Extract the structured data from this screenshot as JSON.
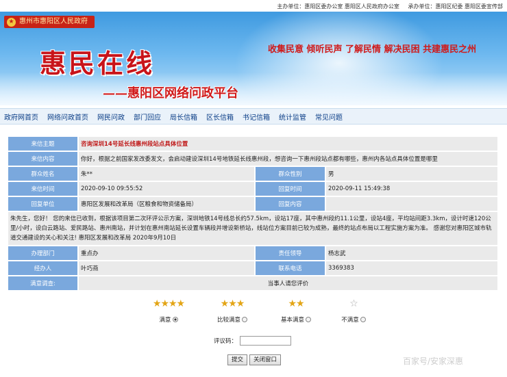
{
  "topbar": {
    "sponsor": "主办单位：惠阳区委办公室 惠阳区人民政府办公室",
    "organizer": "承办单位：惠阳区纪委 惠阳区委宣传部"
  },
  "banner": {
    "gov_badge": "惠州市惠阳区人民政府",
    "main_title": "惠民在线",
    "sub_title": "——惠阳区网络问政平台",
    "slogan": "收集民意  倾听民声  了解民情  解决民困  共建惠民之州"
  },
  "nav": {
    "items": [
      "政府网首页",
      "网络问政首页",
      "网民问政",
      "部门回应",
      "局长信箱",
      "区长信箱",
      "书记信箱",
      "统计监管",
      "常见问题"
    ]
  },
  "detail": {
    "subject_label": "来信主题",
    "subject": "咨询深圳14号延长线惠州段站点具体位置",
    "content_label": "来信内容",
    "content": "你好，根据之前国家发改委发文，会启动建设深圳14号地铁延长线惠州段，想咨询一下惠州段站点都有哪些，惠州内各站点具体位置是哪里",
    "name_label": "群众姓名",
    "name": "朱**",
    "gender_label": "群众性别",
    "gender": "男",
    "sent_time_label": "来信时间",
    "sent_time": "2020-09-10 09:55:52",
    "reply_time_label": "回复时间",
    "reply_time": "2020-09-11 15:49:38",
    "reply_unit_label": "回复单位",
    "reply_unit": "惠阳区发展和改革局（区粮食和物资储备局）",
    "reply_content_label": "回复内容",
    "reply": "朱先生，您好！ 您的来信已收到，根据该项目第二次环评公示方案，深圳地铁14号线总长约57.5km，设站17座，其中惠州段约11.1公里，设站4座，平均站间距3.3km，设计时速120公里/小时，设白云路站、爱民路站、惠州南站，并计划在惠州南站延长设置车辆段并增设新桥站，线站位方案目前已较为成熟，最终的站点布局以工程实施方案为准。 感谢您对惠阳区城市轨道交通建设的关心和关注! 惠阳区发展和改革局 2020年9月10日",
    "dept_label": "办理部门",
    "dept": "重点办",
    "leader_label": "责任领导",
    "leader": "杨志武",
    "handler_label": "经办人",
    "handler": "叶巧燕",
    "phone_label": "联系电话",
    "phone": "3369383",
    "satisfaction_label": "满意调查:",
    "satisfaction_prompt": "当事人请您评价"
  },
  "rating": {
    "options": [
      {
        "stars": "★★★★",
        "label": "满意",
        "selected": true
      },
      {
        "stars": "★★★",
        "label": "比较满意",
        "selected": false
      },
      {
        "stars": "★★",
        "label": "基本满意",
        "selected": false
      },
      {
        "stars": "☆",
        "label": "不满意",
        "selected": false
      }
    ],
    "code_label": "评议码：",
    "code_value": ""
  },
  "buttons": {
    "submit": "提交",
    "close": "关闭窗口"
  },
  "watermark": "百家号/安家深惠"
}
